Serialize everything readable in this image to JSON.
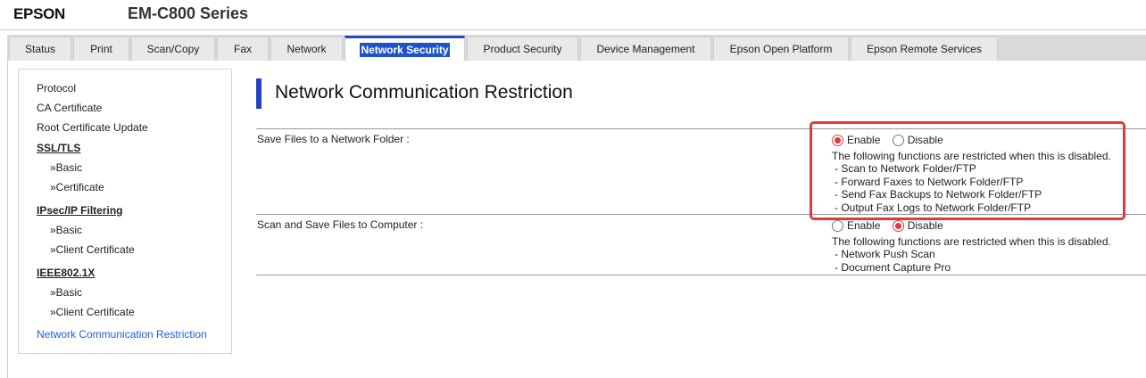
{
  "header": {
    "brand": "EPSON",
    "model": "EM-C800 Series"
  },
  "tabs": [
    {
      "label": "Status"
    },
    {
      "label": "Print"
    },
    {
      "label": "Scan/Copy"
    },
    {
      "label": "Fax"
    },
    {
      "label": "Network"
    },
    {
      "label": "Network Security",
      "active": true
    },
    {
      "label": "Product Security"
    },
    {
      "label": "Device Management"
    },
    {
      "label": "Epson Open Platform"
    },
    {
      "label": "Epson Remote Services"
    }
  ],
  "sidebar": {
    "items": [
      {
        "label": "Protocol"
      },
      {
        "label": "CA Certificate"
      },
      {
        "label": "Root Certificate Update"
      },
      {
        "label": "SSL/TLS",
        "heading": true
      },
      {
        "label": "»Basic"
      },
      {
        "label": "»Certificate"
      },
      {
        "label": "IPsec/IP Filtering",
        "heading": true
      },
      {
        "label": "»Basic"
      },
      {
        "label": "»Client Certificate"
      },
      {
        "label": "IEEE802.1X",
        "heading": true
      },
      {
        "label": "»Basic"
      },
      {
        "label": "»Client Certificate"
      },
      {
        "label": "Network Communication Restriction",
        "current": true
      }
    ]
  },
  "main": {
    "title": "Network Communication Restriction",
    "settings": [
      {
        "label": "Save Files to a Network Folder :",
        "enable_label": "Enable",
        "disable_label": "Disable",
        "selected": "Enable",
        "note": "The following functions are restricted when this is disabled.",
        "items": [
          " - Scan to Network Folder/FTP",
          " - Forward Faxes to Network Folder/FTP",
          " - Send Fax Backups to Network Folder/FTP",
          " - Output Fax Logs to Network Folder/FTP"
        ]
      },
      {
        "label": "Scan and Save Files to Computer :",
        "enable_label": "Enable",
        "disable_label": "Disable",
        "selected": "Disable",
        "note": "The following functions are restricted when this is disabled.",
        "items": [
          " - Network Push Scan",
          " - Document Capture Pro"
        ]
      }
    ]
  },
  "colors": {
    "accent": "#2343c2",
    "active_tab": "#1e53c7",
    "highlight": "#e03a3a",
    "link": "#1f5fd0"
  }
}
